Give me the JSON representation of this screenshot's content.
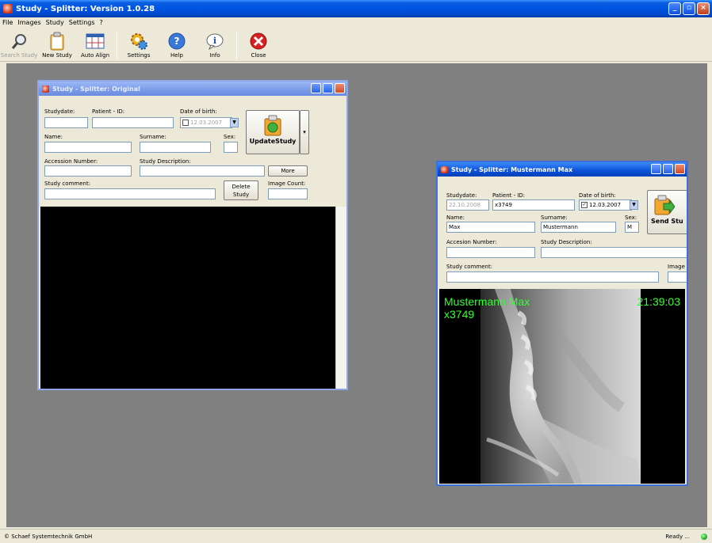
{
  "app": {
    "title": "Study - Splitter: Version 1.0.28"
  },
  "menu": [
    "File",
    "Images",
    "Study",
    "Settings",
    "?"
  ],
  "toolbar": [
    {
      "label": "Search Study",
      "icon": "magnifier-icon",
      "enabled": false
    },
    {
      "label": "New Study",
      "icon": "clipboard-icon",
      "enabled": true
    },
    {
      "label": "Auto Align",
      "icon": "grid-icon",
      "enabled": true
    },
    {
      "label": "Settings",
      "icon": "gears-icon",
      "enabled": true
    },
    {
      "label": "Help",
      "icon": "help-icon",
      "enabled": true
    },
    {
      "label": "Info",
      "icon": "info-icon",
      "enabled": true
    },
    {
      "label": "Close",
      "icon": "close-red-icon",
      "enabled": true
    }
  ],
  "status": {
    "copyright": "© Schaef Systemtechnik GmbH",
    "state": "Ready ...",
    "led_color": "#1aa11a"
  },
  "original_window": {
    "title": "Study - Splitter: Original",
    "labels": {
      "studydate": "Studydate:",
      "patient_id": "Patient - ID:",
      "dob": "Date of birth:",
      "name": "Name:",
      "surname": "Surname:",
      "sex": "Sex:",
      "accession": "Accession Number:",
      "description": "Study Description:",
      "comment": "Study comment:",
      "image_count": "Image Count:"
    },
    "values": {
      "studydate": "",
      "patient_id": "",
      "dob": "12.03.2007",
      "name": "",
      "surname": "",
      "sex": "",
      "accession": "",
      "description": "",
      "comment": "",
      "image_count": ""
    },
    "buttons": {
      "update": "UpdateStudy",
      "more": "More",
      "delete_line1": "Delete",
      "delete_line2": "Study"
    }
  },
  "patient_window": {
    "title": "Study - Splitter: Mustermann Max",
    "labels": {
      "studydate": "Studydate:",
      "patient_id": "Patient - ID:",
      "dob": "Date of birth:",
      "name": "Name:",
      "surname": "Surname:",
      "sex": "Sex:",
      "accession": "Accesion Number:",
      "description": "Study Description:",
      "comment": "Study comment:",
      "image": "Image"
    },
    "values": {
      "studydate": "22.10.2008",
      "patient_id": "x3749",
      "dob": "12.03.2007",
      "name": "Max",
      "surname": "Mustermann",
      "sex": "M",
      "accession": "",
      "description": "",
      "comment": ""
    },
    "buttons": {
      "send": "Send Stu"
    },
    "overlay": {
      "patient_name": "Mustermann Max",
      "patient_id": "x3749",
      "time": "21:39:03"
    }
  }
}
